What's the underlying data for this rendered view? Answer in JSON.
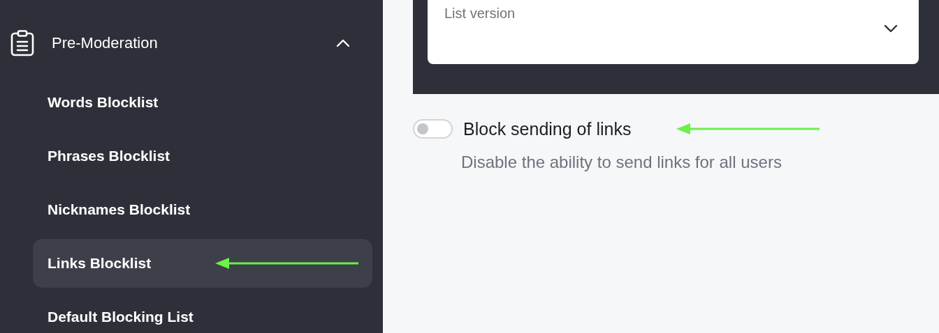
{
  "sidebar": {
    "section": {
      "label": "Pre-Moderation",
      "expanded": true
    },
    "items": [
      {
        "label": "Words Blocklist",
        "selected": false
      },
      {
        "label": "Phrases Blocklist",
        "selected": false
      },
      {
        "label": "Nicknames Blocklist",
        "selected": false
      },
      {
        "label": "Links Blocklist",
        "selected": true
      },
      {
        "label": "Default Blocking List",
        "selected": false
      }
    ]
  },
  "list_version_select": {
    "placeholder": "List version"
  },
  "setting": {
    "label": "Block sending of links",
    "description": "Disable the ability to send links for all users",
    "on": false
  }
}
